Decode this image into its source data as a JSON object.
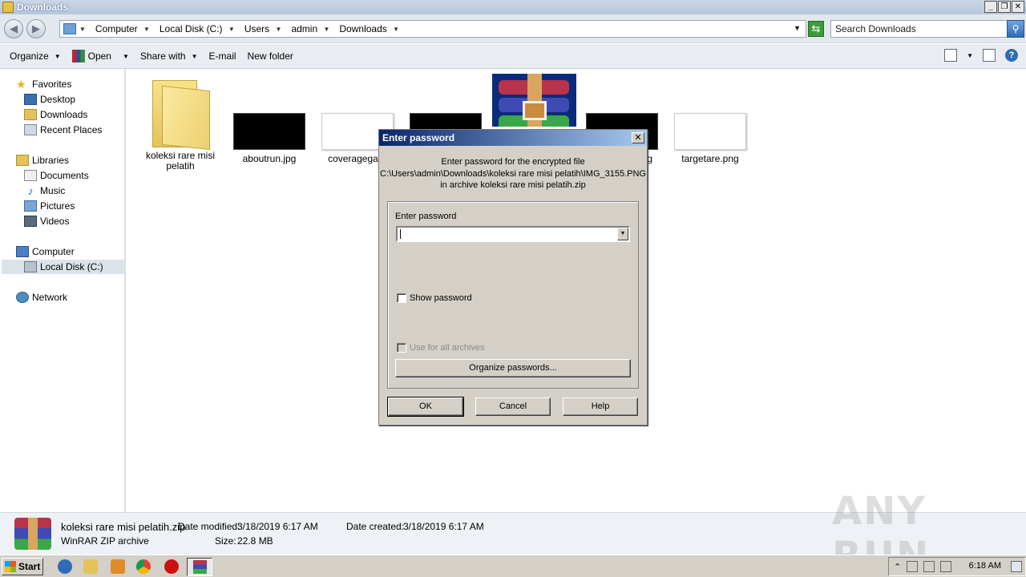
{
  "window": {
    "title": "Downloads"
  },
  "address": {
    "crumbs": [
      "Computer",
      "Local Disk (C:)",
      "Users",
      "admin",
      "Downloads"
    ],
    "search_placeholder": "Search Downloads"
  },
  "toolbar": {
    "organize": "Organize",
    "open": "Open",
    "share_with": "Share with",
    "email": "E-mail",
    "new_folder": "New folder"
  },
  "sidebar": {
    "favorites": "Favorites",
    "desktop": "Desktop",
    "downloads": "Downloads",
    "recent_places": "Recent Places",
    "libraries": "Libraries",
    "documents": "Documents",
    "music": "Music",
    "pictures": "Pictures",
    "videos": "Videos",
    "computer": "Computer",
    "local_disk": "Local Disk (C:)",
    "network": "Network"
  },
  "files": {
    "folder": "koleksi rare misi pelatih",
    "aboutrun": "aboutrun.jpg",
    "coveragegay": "coveragegay.j",
    "partial_g": "g",
    "targetare": "targetare.png"
  },
  "dialog": {
    "title": "Enter password",
    "msg_line1": "Enter password for the encrypted file",
    "msg_line2": "C:\\Users\\admin\\Downloads\\koleksi rare misi pelatih\\IMG_3155.PNG",
    "msg_line3": "in archive koleksi rare misi pelatih.zip",
    "enter_password_label": "Enter password",
    "password_value": "",
    "show_password": "Show password",
    "use_for_all": "Use for all archives",
    "organize_passwords": "Organize passwords...",
    "ok": "OK",
    "cancel": "Cancel",
    "help": "Help",
    "close": "✕"
  },
  "details": {
    "filename": "koleksi rare misi pelatih.zip",
    "type": "WinRAR ZIP archive",
    "date_modified_label": "Date modified:",
    "date_modified": "3/18/2019 6:17 AM",
    "size_label": "Size:",
    "size": "22.8 MB",
    "date_created_label": "Date created:",
    "date_created": "3/18/2019 6:17 AM"
  },
  "watermark": "ANY RUN",
  "taskbar": {
    "start": "Start",
    "clock": "6:18 AM"
  },
  "icons": [
    "folder-icon",
    "winrar-icon",
    "search-icon",
    "refresh-icon",
    "help-icon",
    "star-icon",
    "desktop-icon",
    "computer-icon",
    "network-icon",
    "internet-explorer-icon",
    "explorer-icon",
    "media-player-icon",
    "chrome-icon",
    "stop-icon"
  ]
}
